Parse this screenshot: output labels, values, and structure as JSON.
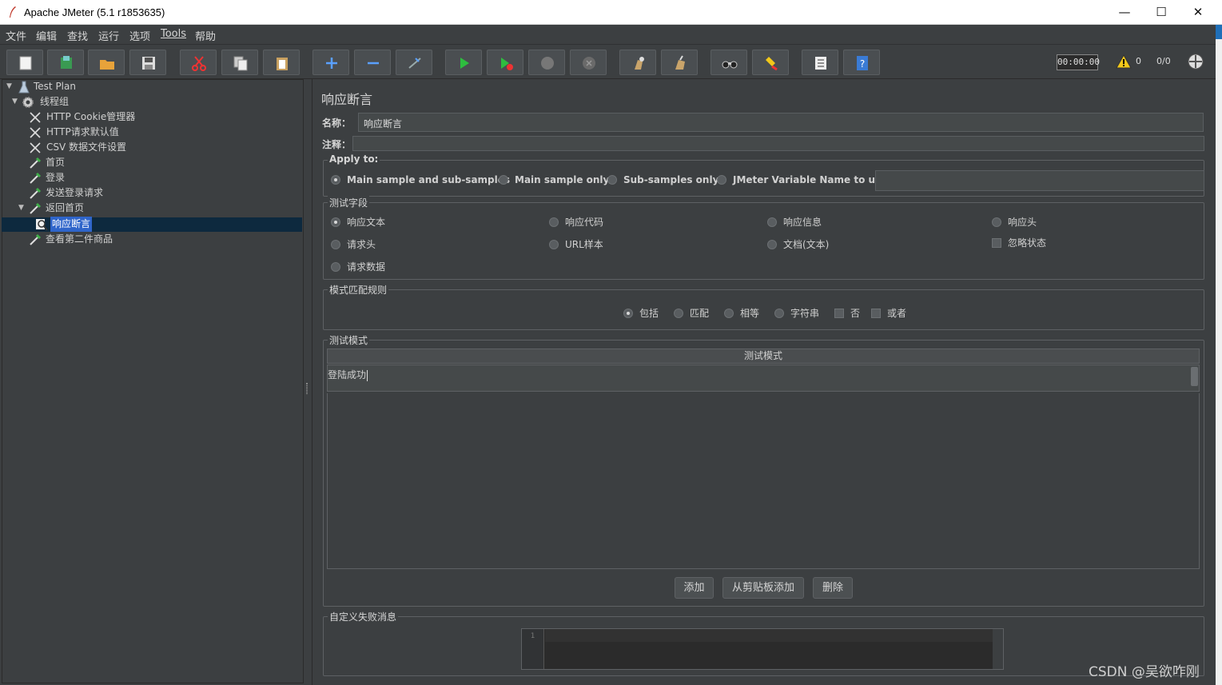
{
  "window": {
    "title": "Apache JMeter (5.1 r1853635)",
    "minimize": "—",
    "maximize": "☐",
    "close": "✕"
  },
  "menu": [
    "文件",
    "编辑",
    "查找",
    "运行",
    "选项",
    "Tools",
    "帮助"
  ],
  "toolbar": {
    "timer": "00:00:00",
    "warning_count": "0",
    "threads": "0/0"
  },
  "tree": {
    "nodes": [
      {
        "label": "Test Plan",
        "icon": "test-plan-icon"
      },
      {
        "label": "线程组",
        "icon": "gear-icon"
      },
      {
        "label": "HTTP Cookie管理器",
        "icon": "wrench-scissors-icon"
      },
      {
        "label": "HTTP请求默认值",
        "icon": "wrench-scissors-icon"
      },
      {
        "label": "CSV 数据文件设置",
        "icon": "wrench-scissors-icon"
      },
      {
        "label": "首页",
        "icon": "pipette-icon"
      },
      {
        "label": "登录",
        "icon": "pipette-icon"
      },
      {
        "label": "发送登录请求",
        "icon": "pipette-icon"
      },
      {
        "label": "返回首页",
        "icon": "pipette-icon"
      },
      {
        "label": "响应断言",
        "icon": "magnifier-icon"
      },
      {
        "label": "查看第二件商品",
        "icon": "pipette-icon"
      }
    ]
  },
  "panel": {
    "title": "响应断言",
    "name_label": "名称：",
    "name_value": "响应断言",
    "comment_label": "注释：",
    "apply_to": {
      "legend": "Apply to:",
      "options": [
        "Main sample and sub-samples",
        "Main sample only",
        "Sub-samples only",
        "JMeter Variable Name to use"
      ],
      "selected": "Main sample and sub-samples",
      "variable_value": ""
    },
    "test_field": {
      "legend": "测试字段",
      "options": [
        "响应文本",
        "响应代码",
        "响应信息",
        "响应头",
        "请求头",
        "URL样本",
        "文档(文本)",
        "请求数据"
      ],
      "selected": "响应文本",
      "ignore_status": "忽略状态"
    },
    "match_rules": {
      "legend": "模式匹配规则",
      "radios": [
        "包括",
        "匹配",
        "相等",
        "字符串"
      ],
      "selected": "包括",
      "checks": [
        "否",
        "或者"
      ]
    },
    "patterns": {
      "legend": "测试模式",
      "column": "测试模式",
      "rows": [
        "登陆成功"
      ],
      "buttons": [
        "添加",
        "从剪贴板添加",
        "删除"
      ]
    },
    "failure_message": {
      "legend": "自定义失败消息",
      "line_number": "1",
      "value": ""
    }
  },
  "watermark": "CSDN @吴欲咋刚"
}
